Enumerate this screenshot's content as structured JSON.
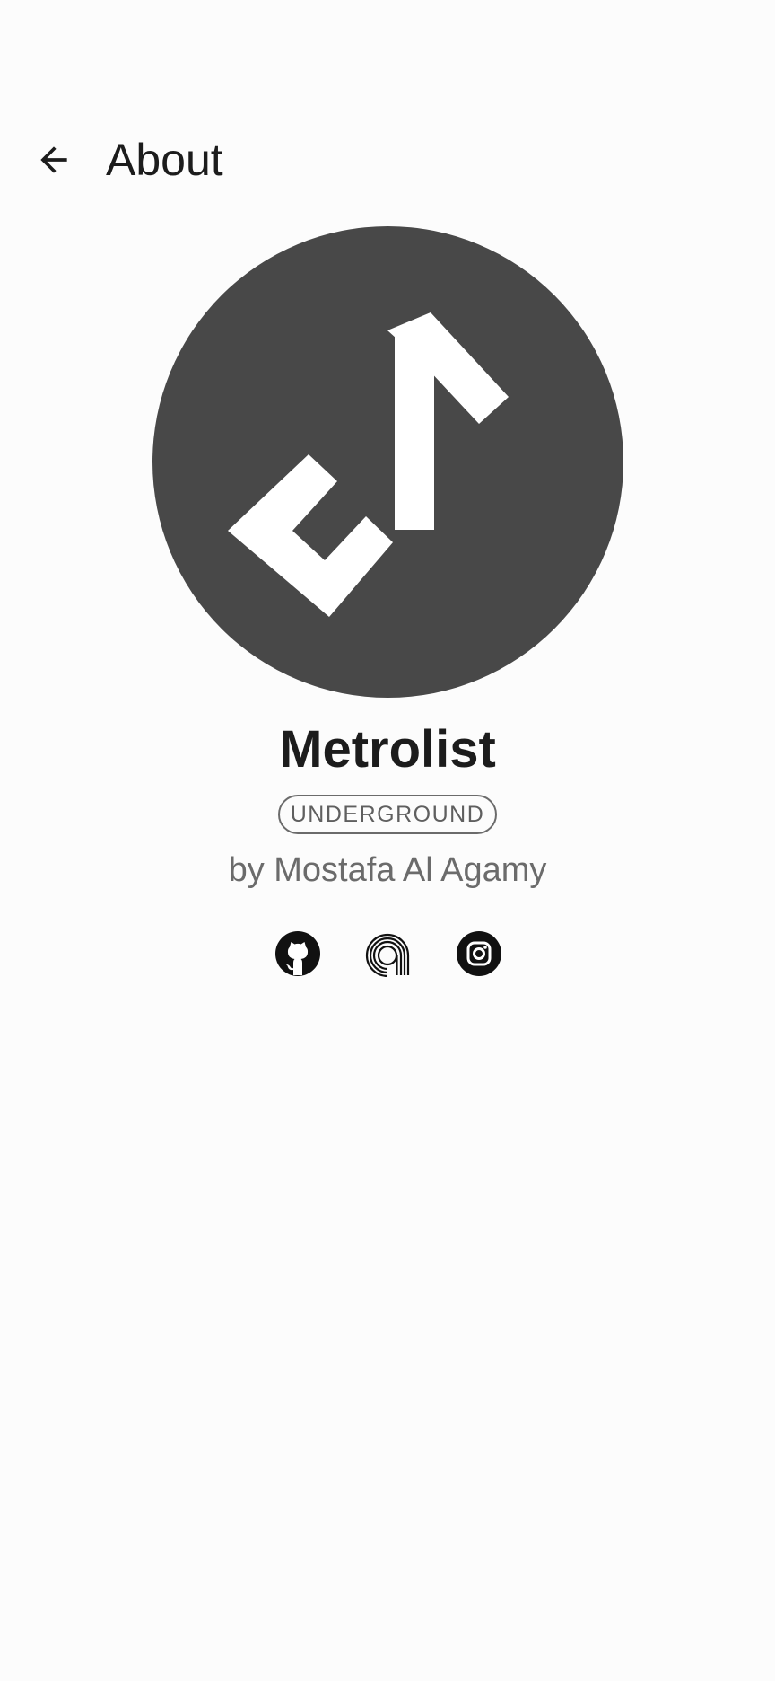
{
  "header": {
    "title": "About",
    "back_icon": "arrow-back-icon"
  },
  "app": {
    "logo_icon": "music-note-logo-icon",
    "logo_background": "#484848",
    "name": "Metrolist",
    "badge": "UNDERGROUND",
    "author": "by Mostafa Al Agamy"
  },
  "links": [
    {
      "icon": "github-icon"
    },
    {
      "icon": "at-sign-icon"
    },
    {
      "icon": "instagram-icon"
    }
  ],
  "colors": {
    "background": "#fcfcfc",
    "text_primary": "#1c1c1c",
    "text_secondary": "#6b6b6b"
  }
}
